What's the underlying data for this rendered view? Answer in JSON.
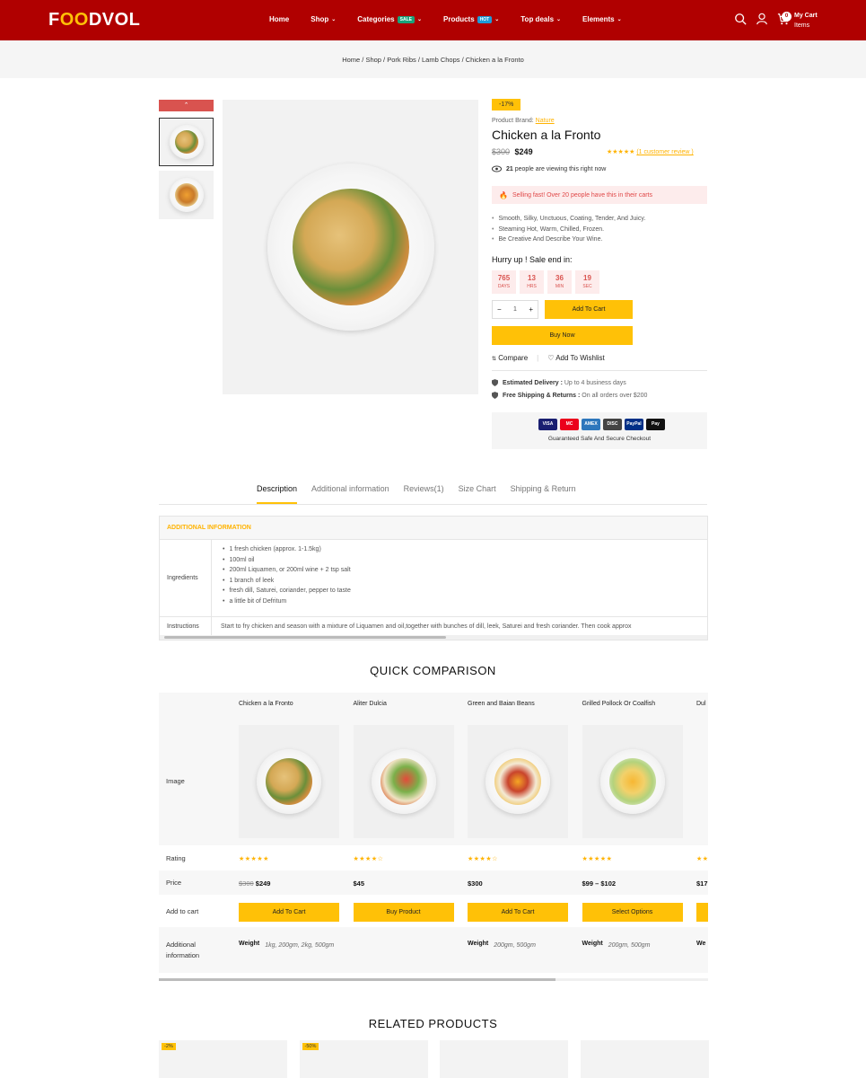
{
  "header": {
    "logo": "FOODVOL",
    "nav": [
      {
        "label": "Home",
        "chevron": false
      },
      {
        "label": "Shop",
        "chevron": true
      },
      {
        "label": "Categories",
        "badge": "SALE",
        "chevron": true
      },
      {
        "label": "Products",
        "badge": "HOT",
        "chevron": true
      },
      {
        "label": "Top deals",
        "chevron": true
      },
      {
        "label": "Elements",
        "chevron": true
      }
    ],
    "cart_count": "0",
    "cart_title": "My Cart",
    "cart_sub": "Items"
  },
  "breadcrumb": "Home / Shop / Pork Ribs / Lamb Chops / Chicken a la Fronto",
  "product": {
    "sale_tag": "-17%",
    "brand_label": "Product Brand:",
    "brand": "Nature",
    "title": "Chicken a la Fronto",
    "old_price": "$300",
    "price": "$249",
    "stars": "★★★★★",
    "review_link": "(1 customer review )",
    "viewing_count": "21",
    "viewing_text": "people are viewing this right now",
    "selling_fast": "Selling fast! Over 20 people have this in their carts",
    "bullets": [
      "Smooth, Silky, Unctuous, Coating, Tender, And Juicy.",
      "Steaming Hot, Warm, Chilled, Frozen.",
      "Be Creative And Describe Your Wine."
    ],
    "hurry": "Hurry up ! Sale end in:",
    "countdown": [
      {
        "n": "765",
        "l": "DAYS"
      },
      {
        "n": "13",
        "l": "HRS"
      },
      {
        "n": "36",
        "l": "MIN"
      },
      {
        "n": "19",
        "l": "SEC"
      }
    ],
    "qty": "1",
    "add_to_cart": "Add To Cart",
    "buy_now": "Buy Now",
    "compare": "Compare",
    "wishlist": "Add To Wishlist",
    "delivery_label": "Estimated Delivery :",
    "delivery_value": "Up to 4 business days",
    "shipping_label": "Free Shipping & Returns :",
    "shipping_value": "On all orders over $200",
    "cards": [
      {
        "label": "VISA",
        "color": "#1a1f71"
      },
      {
        "label": "MC",
        "color": "#eb001b"
      },
      {
        "label": "AMEX",
        "color": "#2e77bc"
      },
      {
        "label": "DISC",
        "color": "#444444"
      },
      {
        "label": "PayPal",
        "color": "#003087"
      },
      {
        "label": "Pay",
        "color": "#111111"
      }
    ],
    "secure_text": "Guaranteed Safe And Secure Checkout"
  },
  "tabs": [
    "Description",
    "Additional information",
    "Reviews(1)",
    "Size Chart",
    "Shipping & Return"
  ],
  "additional_info": {
    "heading": "ADDITIONAL INFORMATION",
    "ingredients_label": "Ingredients",
    "ingredients": [
      "1 fresh chicken (approx. 1-1.5kg)",
      "100ml oil",
      "200ml Liquamen, or 200ml wine + 2 tsp salt",
      "1 branch of leek",
      "fresh dill, Saturei, coriander, pepper to taste",
      "a little bit of Defritum"
    ],
    "instructions_label": "Instructions",
    "instructions": "Start to fry chicken and season with a mixture of Liquamen and oil,together with bunches of dill, leek, Saturei and fresh coriander. Then cook approx"
  },
  "comparison": {
    "title": "QUICK COMPARISON",
    "row_labels": {
      "image": "Image",
      "rating": "Rating",
      "price": "Price",
      "add": "Add to cart",
      "additional": "Additional information"
    },
    "weight_label": "Weight",
    "products": [
      {
        "name": "Chicken a la Fronto",
        "stars": "★★★★★",
        "old_price": "$300",
        "price": "$249",
        "button": "Add To Cart",
        "weight": "1kg, 200gm, 2kg, 500gm",
        "food": "noodle"
      },
      {
        "name": "Aliter Dulcia",
        "stars": "★★★★☆",
        "old_price": "",
        "price": "$45",
        "button": "Buy Product",
        "weight": "",
        "food": "salad"
      },
      {
        "name": "Green and Baian Beans",
        "stars": "★★★★☆",
        "old_price": "",
        "price": "$300",
        "button": "Add To Cart",
        "weight": "200gm, 500gm",
        "food": "beans"
      },
      {
        "name": "Grilled Pollock Or Coalfish",
        "stars": "★★★★★",
        "old_price": "",
        "price": "$99 – $102",
        "button": "Select Options",
        "weight": "200gm, 500gm",
        "food": "fish"
      },
      {
        "name": "Dul",
        "stars": "★★",
        "old_price": "",
        "price": "$17",
        "button": "",
        "weight": "We",
        "food": "none"
      }
    ]
  },
  "related": {
    "title": "RELATED PRODUCTS",
    "tags": [
      "-2%",
      "-50%",
      "",
      ""
    ]
  }
}
